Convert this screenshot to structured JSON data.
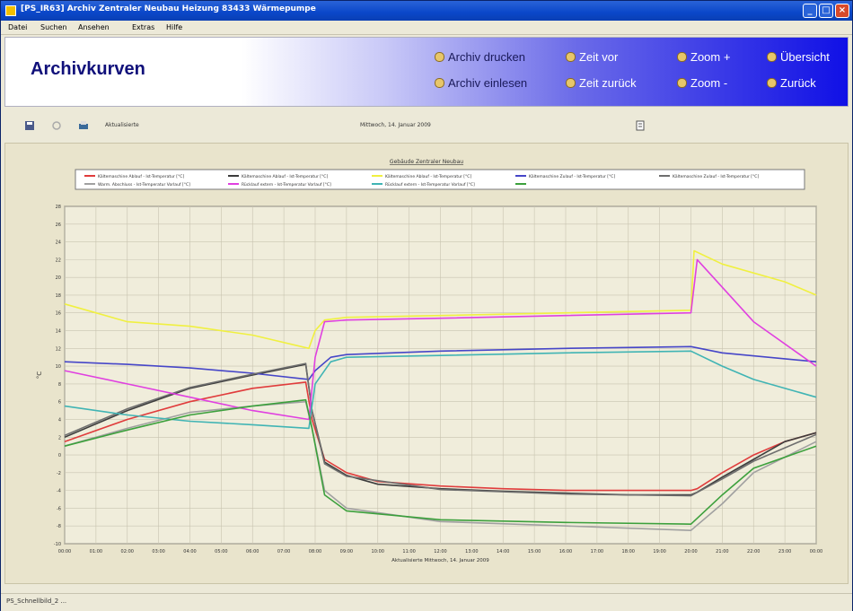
{
  "window": {
    "title": "[PS_IR63] Archiv Zentraler Neubau Heizung 83433 Wärmepumpe",
    "buttons": {
      "minimize": "_",
      "maximize": "□",
      "close": "×"
    }
  },
  "menu": [
    "Datei",
    "Suchen",
    "Ansehen",
    "Extras",
    "Hilfe"
  ],
  "banner": {
    "title": "Archivkurven",
    "buttons": [
      "Archiv drucken",
      "Zeit vor",
      "Zoom +",
      "Übersicht",
      "Archiv einlesen",
      "Zeit zurück",
      "Zoom -",
      "Zurück"
    ]
  },
  "toolbar": {
    "left_label": "Aktualisierte",
    "date_label": "Mittwoch, 14. Januar 2009"
  },
  "statusbar": {
    "text": "PS_Schnellbild_2 ..."
  },
  "chart_data": {
    "type": "line",
    "title": "Gebäude Zentraler Neubau",
    "xlabel": "Aktualisierte Mittwoch, 14. Januar 2009",
    "ylabel": "°C",
    "ylim": [
      -10,
      28
    ],
    "grid": true,
    "legend_position": "top",
    "x": [
      "00:00",
      "01:00",
      "02:00",
      "03:00",
      "04:00",
      "05:00",
      "06:00",
      "07:00",
      "08:00",
      "09:00",
      "10:00",
      "11:00",
      "12:00",
      "13:00",
      "14:00",
      "15:00",
      "16:00",
      "17:00",
      "18:00",
      "19:00",
      "20:00",
      "21:00",
      "22:00",
      "23:00",
      "00:00"
    ],
    "series": [
      {
        "name": "Kältemaschine Ablauf - Ist-Temperatur [°C]",
        "color": "#e03c3c",
        "points": [
          [
            0,
            1.5
          ],
          [
            2,
            4
          ],
          [
            4,
            6
          ],
          [
            6,
            7.5
          ],
          [
            7.7,
            8.2
          ],
          [
            7.9,
            4
          ],
          [
            8.3,
            -0.5
          ],
          [
            9,
            -2
          ],
          [
            10,
            -3
          ],
          [
            12,
            -3.5
          ],
          [
            14,
            -3.8
          ],
          [
            16,
            -4
          ],
          [
            18,
            -4
          ],
          [
            20,
            -4
          ],
          [
            20.2,
            -3.8
          ],
          [
            21,
            -2
          ],
          [
            22,
            0
          ],
          [
            23,
            1.5
          ],
          [
            24,
            2.5
          ]
        ]
      },
      {
        "name": "Kältemaschine Ablauf - Ist-Temperatur [°C]",
        "color": "#3c3c3c",
        "points": [
          [
            0,
            2
          ],
          [
            2,
            5
          ],
          [
            4,
            7.5
          ],
          [
            6,
            9
          ],
          [
            7.7,
            10.2
          ],
          [
            7.9,
            5
          ],
          [
            8.3,
            -0.8
          ],
          [
            9,
            -2.3
          ],
          [
            10,
            -3.3
          ],
          [
            12,
            -3.8
          ],
          [
            14,
            -4.1
          ],
          [
            16,
            -4.3
          ],
          [
            18,
            -4.5
          ],
          [
            20,
            -4.5
          ],
          [
            20.2,
            -4.2
          ],
          [
            21,
            -2.5
          ],
          [
            22,
            -0.5
          ],
          [
            23,
            1.5
          ],
          [
            24,
            2.5
          ]
        ]
      },
      {
        "name": "Kältemaschine Ablauf - Ist-Temperatur [°C]",
        "color": "#f0f040",
        "points": [
          [
            0,
            17
          ],
          [
            1,
            16
          ],
          [
            2,
            15
          ],
          [
            4,
            14.5
          ],
          [
            6,
            13.5
          ],
          [
            7.8,
            12
          ],
          [
            8,
            14
          ],
          [
            8.3,
            15.2
          ],
          [
            9,
            15.5
          ],
          [
            12,
            15.7
          ],
          [
            16,
            16
          ],
          [
            20,
            16.3
          ],
          [
            20.1,
            23
          ],
          [
            21,
            21.5
          ],
          [
            23,
            19.5
          ],
          [
            24,
            18
          ]
        ]
      },
      {
        "name": "Kältemaschine Zulauf - Ist-Temperatur [°C]",
        "color": "#4646c8",
        "points": [
          [
            0,
            10.5
          ],
          [
            2,
            10.2
          ],
          [
            4,
            9.8
          ],
          [
            6,
            9.2
          ],
          [
            7.8,
            8.5
          ],
          [
            8,
            9.5
          ],
          [
            8.5,
            11
          ],
          [
            9,
            11.3
          ],
          [
            12,
            11.7
          ],
          [
            16,
            12
          ],
          [
            18,
            12.1
          ],
          [
            20,
            12.2
          ],
          [
            21,
            11.5
          ],
          [
            24,
            10.5
          ]
        ]
      },
      {
        "name": "Kältemaschine Zulauf - Ist-Temperatur [°C]",
        "color": "#6e6e6e",
        "points": [
          [
            0,
            2.2
          ],
          [
            2,
            5.2
          ],
          [
            4,
            7.6
          ],
          [
            6,
            9.1
          ],
          [
            7.7,
            10.3
          ],
          [
            7.9,
            5
          ],
          [
            8.3,
            -1
          ],
          [
            9,
            -2.4
          ],
          [
            12,
            -3.9
          ],
          [
            16,
            -4.4
          ],
          [
            20,
            -4.6
          ],
          [
            21,
            -2.7
          ],
          [
            22,
            -0.7
          ],
          [
            24,
            2.3
          ]
        ]
      },
      {
        "name": "Warm. Abschluss - Ist-Temperatur Vorlauf [°C]",
        "color": "#a0a0a0",
        "points": [
          [
            0,
            1
          ],
          [
            2,
            3
          ],
          [
            4,
            4.8
          ],
          [
            6,
            5.5
          ],
          [
            7.7,
            6
          ],
          [
            7.9,
            3
          ],
          [
            8.3,
            -4
          ],
          [
            9,
            -6
          ],
          [
            12,
            -7.5
          ],
          [
            16,
            -8
          ],
          [
            20,
            -8.5
          ],
          [
            21,
            -5.5
          ],
          [
            22,
            -2
          ],
          [
            24,
            1.5
          ]
        ]
      },
      {
        "name": "Rücklauf extern - Ist-Temperatur Vorlauf [°C]",
        "color": "#e040e0",
        "points": [
          [
            0,
            9.5
          ],
          [
            2,
            8
          ],
          [
            4,
            6.5
          ],
          [
            6,
            5
          ],
          [
            7.8,
            4
          ],
          [
            8,
            11
          ],
          [
            8.3,
            15
          ],
          [
            9,
            15.2
          ],
          [
            12,
            15.4
          ],
          [
            16,
            15.7
          ],
          [
            20,
            16
          ],
          [
            20.2,
            22
          ],
          [
            22,
            15
          ],
          [
            24,
            10
          ]
        ]
      },
      {
        "name": "Rücklauf extern - Ist-Temperatur Vorlauf [°C]",
        "color": "#40b4b4",
        "points": [
          [
            0,
            5.5
          ],
          [
            2,
            4.5
          ],
          [
            4,
            3.8
          ],
          [
            6,
            3.4
          ],
          [
            7.8,
            3
          ],
          [
            8,
            8
          ],
          [
            8.5,
            10.5
          ],
          [
            9,
            11
          ],
          [
            12,
            11.2
          ],
          [
            16,
            11.5
          ],
          [
            20,
            11.7
          ],
          [
            21,
            10
          ],
          [
            22,
            8.5
          ],
          [
            24,
            6.5
          ]
        ]
      },
      {
        "name": "",
        "color": "#3ca03c",
        "points": [
          [
            0,
            1
          ],
          [
            2,
            2.8
          ],
          [
            4,
            4.5
          ],
          [
            6,
            5.5
          ],
          [
            7.7,
            6.2
          ],
          [
            7.9,
            3
          ],
          [
            8.3,
            -4.5
          ],
          [
            9,
            -6.3
          ],
          [
            12,
            -7.3
          ],
          [
            16,
            -7.6
          ],
          [
            20,
            -7.8
          ],
          [
            21,
            -4.5
          ],
          [
            22,
            -1.5
          ],
          [
            24,
            1
          ]
        ]
      }
    ]
  }
}
